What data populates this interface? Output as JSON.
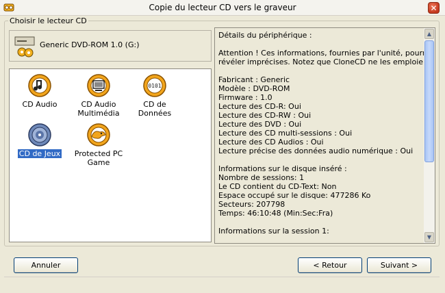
{
  "window": {
    "title": "Copie du lecteur CD vers le graveur"
  },
  "group": {
    "label": "Choisir le lecteur CD"
  },
  "drive": {
    "label": "Generic DVD-ROM 1.0 (G:)"
  },
  "profiles": [
    {
      "label": "CD Audio",
      "icon": "cd-audio-icon",
      "selected": false
    },
    {
      "label": "CD Audio\nMultimédia",
      "icon": "cd-multimedia-icon",
      "selected": false
    },
    {
      "label": "CD de Données",
      "icon": "cd-data-icon",
      "selected": false
    },
    {
      "label": "CD de Jeux",
      "icon": "cd-game-icon",
      "selected": true
    },
    {
      "label": "Protected PC\nGame",
      "icon": "protected-game-icon",
      "selected": false
    }
  ],
  "info": [
    "Détails du périphérique :",
    "",
    "Attention ! Ces informations, fournies par l'unité, pourraient se",
    "révéler imprécises. Notez que CloneCD ne les emploie.",
    "",
    "Fabricant : Generic",
    "Modèle : DVD-ROM",
    "Firmware : 1.0",
    "Lecture des CD-R: Oui",
    "Lecture des CD-RW : Oui",
    "Lecture des DVD : Oui",
    "Lecture des CD multi-sessions : Oui",
    "Lecture des CD Audios : Oui",
    "Lecture précise des données audio numérique : Oui",
    "",
    "Informations sur le disque inséré :",
    "Nombre de sessions: 1",
    "Le CD contient du CD-Text: Non",
    "Espace occupé sur le disque: 477286 Ko",
    "Secteurs: 207798",
    "Temps: 46:10:48 (Min:Sec:Fra)",
    "",
    "Informations sur la session 1:"
  ],
  "buttons": {
    "cancel": "Annuler",
    "back": "< Retour",
    "next": "Suivant >"
  },
  "colors": {
    "accent": "#316ac5",
    "icon_orange": "#f2a51c"
  }
}
